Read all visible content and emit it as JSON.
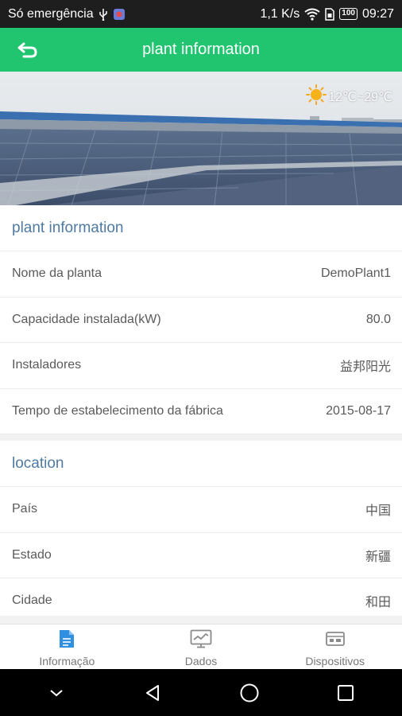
{
  "status_bar": {
    "carrier": "Só emergência",
    "network_speed": "1,1 K/s",
    "battery": "100",
    "time": "09:27"
  },
  "header": {
    "title": "plant information",
    "back_icon": "back-arrow-icon"
  },
  "banner": {
    "weather_icon": "sun-icon",
    "temperature": "12℃~29℃"
  },
  "sections": [
    {
      "title": "plant information",
      "rows": [
        {
          "label": "Nome da planta",
          "value": "DemoPlant1"
        },
        {
          "label": "Capacidade instalada(kW)",
          "value": "80.0"
        },
        {
          "label": "Instaladores",
          "value": "益邦阳光"
        },
        {
          "label": "Tempo de estabelecimento da fábrica",
          "value": "2015-08-17"
        }
      ]
    },
    {
      "title": "location",
      "rows": [
        {
          "label": "País",
          "value": "中国"
        },
        {
          "label": "Estado",
          "value": "新疆"
        },
        {
          "label": "Cidade",
          "value": "和田"
        }
      ]
    }
  ],
  "tabs": [
    {
      "label": "Informação",
      "icon": "document-icon",
      "active": true
    },
    {
      "label": "Dados",
      "icon": "monitor-chart-icon",
      "active": false
    },
    {
      "label": "Dispositivos",
      "icon": "device-icon",
      "active": false
    }
  ],
  "colors": {
    "accent": "#21c46f",
    "section_title": "#4f7aa3",
    "active_tab_icon": "#2f8fe0",
    "inactive_tab_icon": "#8a8a8a"
  }
}
